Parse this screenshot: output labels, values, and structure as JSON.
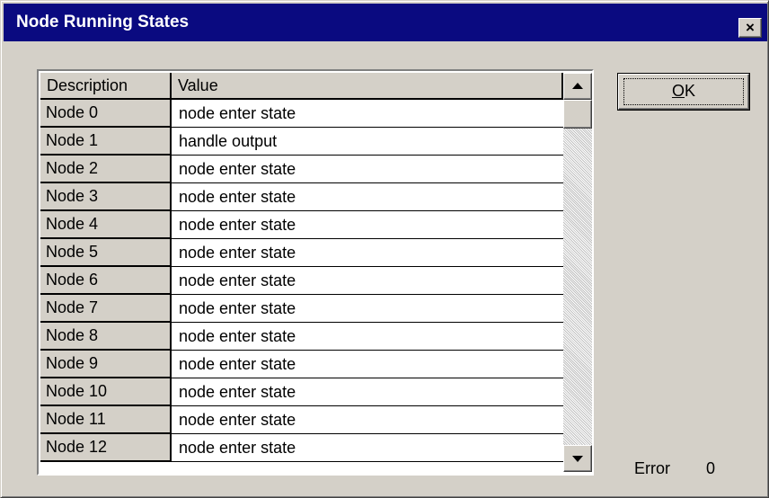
{
  "window": {
    "title": "Node Running States",
    "close_glyph": "×"
  },
  "grid": {
    "columns": [
      "Description",
      "Value"
    ],
    "rows": [
      {
        "description": "Node 0",
        "value": "node enter state"
      },
      {
        "description": "Node 1",
        "value": "handle output"
      },
      {
        "description": "Node 2",
        "value": "node enter state"
      },
      {
        "description": "Node 3",
        "value": "node enter state"
      },
      {
        "description": "Node 4",
        "value": "node enter state"
      },
      {
        "description": "Node 5",
        "value": "node enter state"
      },
      {
        "description": "Node 6",
        "value": "node enter state"
      },
      {
        "description": "Node 7",
        "value": "node enter state"
      },
      {
        "description": "Node 8",
        "value": "node enter state"
      },
      {
        "description": "Node 9",
        "value": "node enter state"
      },
      {
        "description": "Node 10",
        "value": "node enter state"
      },
      {
        "description": "Node 11",
        "value": "node enter state"
      },
      {
        "description": "Node 12",
        "value": "node enter state"
      }
    ]
  },
  "buttons": {
    "ok_mnemonic": "O",
    "ok_rest": "K"
  },
  "status": {
    "error_label": "Error",
    "error_value": "0"
  },
  "icons": {
    "close": "close-icon",
    "scroll_up": "arrow-up-icon",
    "scroll_down": "arrow-down-icon"
  },
  "colors": {
    "titlebar": "#0a0a80",
    "face": "#d4d0c8",
    "cell": "#ffffff"
  }
}
